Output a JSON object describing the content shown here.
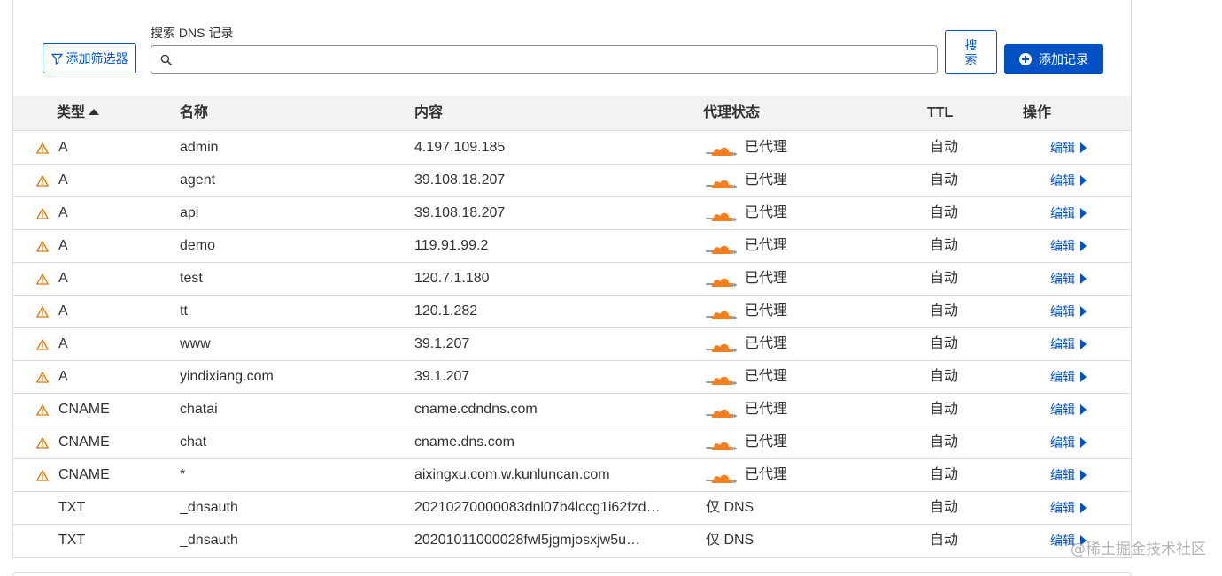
{
  "toolbar": {
    "filter_label": "添加筛选器",
    "search_label": "搜索 DNS 记录",
    "search_value": "",
    "search_button": "搜索",
    "add_label": "添加记录"
  },
  "table": {
    "headers": {
      "type": "类型",
      "name": "名称",
      "content": "内容",
      "proxy": "代理状态",
      "ttl": "TTL",
      "actions": "操作"
    },
    "rows": [
      {
        "warn": true,
        "type": "A",
        "name": "admin",
        "content": "4.197.109.185",
        "proxy": "已代理",
        "proxied": true,
        "ttl": "自动",
        "action": "编辑"
      },
      {
        "warn": true,
        "type": "A",
        "name": "agent",
        "content": "39.108.18.207",
        "proxy": "已代理",
        "proxied": true,
        "ttl": "自动",
        "action": "编辑"
      },
      {
        "warn": true,
        "type": "A",
        "name": "api",
        "content": "39.108.18.207",
        "proxy": "已代理",
        "proxied": true,
        "ttl": "自动",
        "action": "编辑"
      },
      {
        "warn": true,
        "type": "A",
        "name": "demo",
        "content": "119.91.99.2",
        "proxy": "已代理",
        "proxied": true,
        "ttl": "自动",
        "action": "编辑"
      },
      {
        "warn": true,
        "type": "A",
        "name": "test",
        "content": "120.7.1.180",
        "proxy": "已代理",
        "proxied": true,
        "ttl": "自动",
        "action": "编辑"
      },
      {
        "warn": true,
        "type": "A",
        "name": "tt",
        "content": "120.1.282",
        "proxy": "已代理",
        "proxied": true,
        "ttl": "自动",
        "action": "编辑"
      },
      {
        "warn": true,
        "type": "A",
        "name": "www",
        "content": "39.1.207",
        "proxy": "已代理",
        "proxied": true,
        "ttl": "自动",
        "action": "编辑"
      },
      {
        "warn": true,
        "type": "A",
        "name": "yindixiang.com",
        "content": "39.1.207",
        "proxy": "已代理",
        "proxied": true,
        "ttl": "自动",
        "action": "编辑"
      },
      {
        "warn": true,
        "type": "CNAME",
        "name": "chatai",
        "content": "cname.cdndns.com",
        "proxy": "已代理",
        "proxied": true,
        "ttl": "自动",
        "action": "编辑"
      },
      {
        "warn": true,
        "type": "CNAME",
        "name": "chat",
        "content": "cname.dns.com",
        "proxy": "已代理",
        "proxied": true,
        "ttl": "自动",
        "action": "编辑"
      },
      {
        "warn": true,
        "type": "CNAME",
        "name": "*",
        "content": "aixingxu.com.w.kunluncan.com",
        "proxy": "已代理",
        "proxied": true,
        "ttl": "自动",
        "action": "编辑"
      },
      {
        "warn": false,
        "type": "TXT",
        "name": "_dnsauth",
        "content": "20210270000083dnl07b4lccg1i62fzd…",
        "proxy": "仅 DNS",
        "proxied": false,
        "ttl": "自动",
        "action": "编辑"
      },
      {
        "warn": false,
        "type": "TXT",
        "name": "_dnsauth",
        "content": "20201011000028fwl5jgmjosxjw5u…",
        "proxy": "仅 DNS",
        "proxied": false,
        "ttl": "自动",
        "action": "编辑"
      }
    ]
  },
  "watermark": "@稀土掘金技术社区",
  "colors": {
    "accent": "#0051c3",
    "warning": "#e07b00",
    "cloud": "#f38020"
  }
}
